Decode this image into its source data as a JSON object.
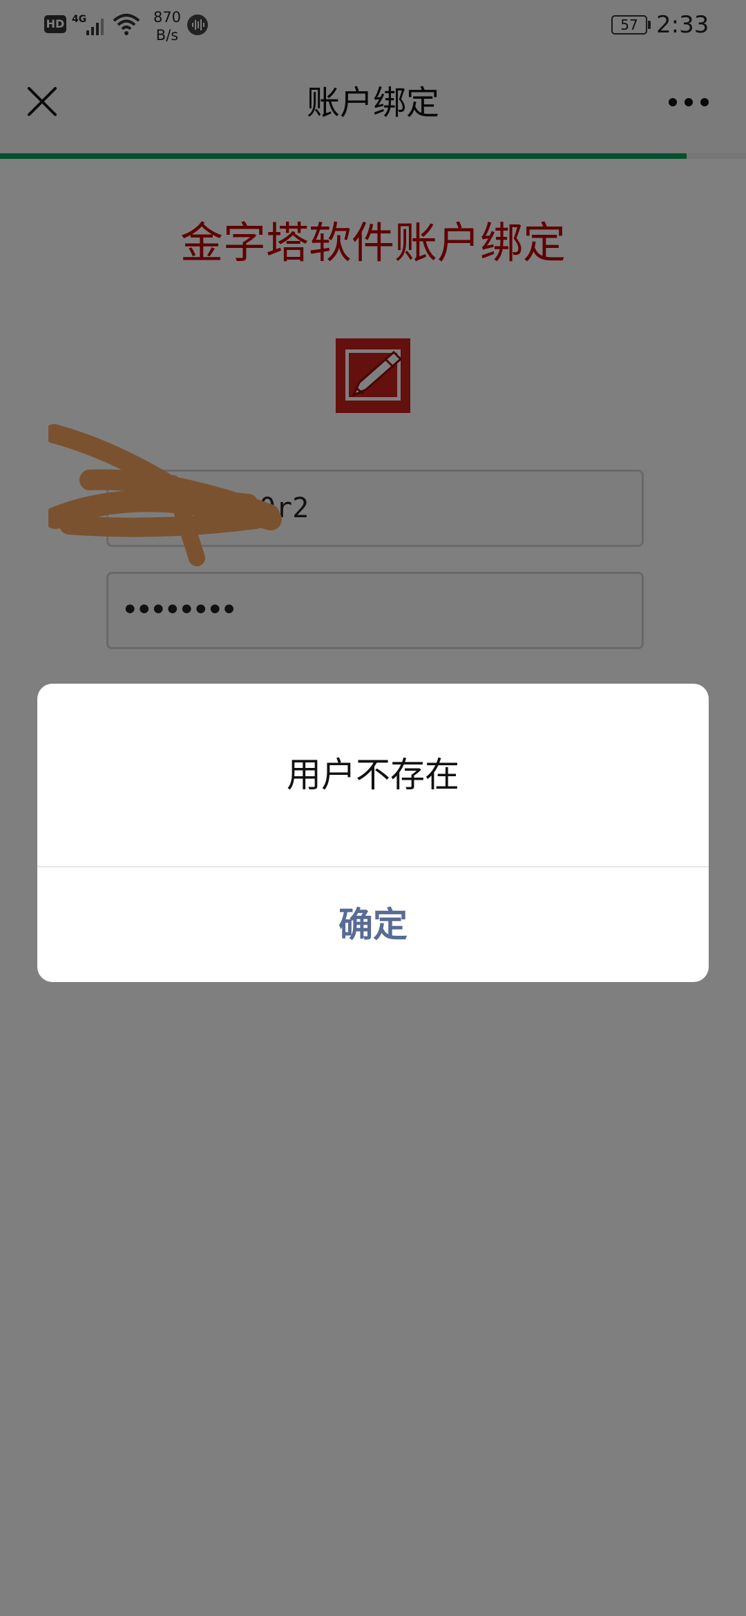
{
  "status_bar": {
    "hd_label": "HD",
    "network_type": "4G",
    "speed_value": "870",
    "speed_unit": "B/s",
    "battery_level": "57",
    "time": "2:33"
  },
  "nav_bar": {
    "title": "账户绑定",
    "close_icon": "close-icon",
    "more_icon": "more-icon"
  },
  "loading_progress": 0.92,
  "page": {
    "heading": "金字塔软件账户绑定",
    "logo_icon": "pencil-logo-icon",
    "username_visible_fragment": "0r2",
    "password_mask": "••••••••"
  },
  "dialog": {
    "message": "用户不存在",
    "confirm_label": "确定"
  },
  "colors": {
    "heading": "#c00000",
    "progress": "#07a35a",
    "confirm": "#576b95",
    "redaction": "#f4a460"
  }
}
